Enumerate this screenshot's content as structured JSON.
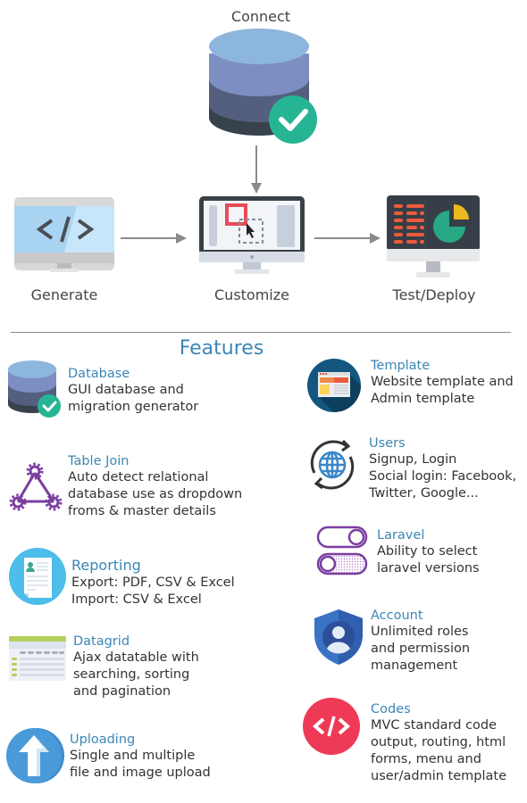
{
  "workflow": {
    "steps": [
      {
        "id": "connect",
        "label": "Connect",
        "icon": "database-check-icon"
      },
      {
        "id": "generate",
        "label": "Generate",
        "icon": "monitor-code-icon"
      },
      {
        "id": "customize",
        "label": "Customize",
        "icon": "monitor-editor-icon"
      },
      {
        "id": "test_deploy",
        "label": "Test/Deploy",
        "icon": "monitor-dashboard-icon"
      }
    ],
    "arrows": [
      {
        "from": "connect",
        "to": "customize"
      },
      {
        "from": "generate",
        "to": "customize"
      },
      {
        "from": "customize",
        "to": "test_deploy"
      }
    ]
  },
  "features": {
    "title": "Features",
    "left": [
      {
        "title": "Database",
        "desc": "GUI database and\nmigration generator",
        "icon": "database-check-icon"
      },
      {
        "title": "Table Join",
        "desc": "Auto detect relational\ndatabase use as dropdown\nfroms & master details",
        "icon": "gears-network-icon"
      },
      {
        "title": "Reporting",
        "desc": "Export: PDF, CSV & Excel\nImport: CSV & Excel",
        "icon": "document-report-icon"
      },
      {
        "title": "Datagrid",
        "desc": "Ajax datatable with\nsearching, sorting\nand pagination",
        "icon": "datagrid-table-icon"
      },
      {
        "title": "Uploading",
        "desc": "Single and multiple\nfile and image upload",
        "icon": "upload-arrow-icon"
      }
    ],
    "right": [
      {
        "title": "Template",
        "desc": "Website template and\nAdmin template",
        "icon": "website-template-icon"
      },
      {
        "title": "Users",
        "desc": "Signup, Login\nSocial login: Facebook,\nTwitter, Google...",
        "icon": "globe-sync-icon"
      },
      {
        "title": "Laravel",
        "desc": "Ability to select\nlaravel versions",
        "icon": "toggle-switches-icon"
      },
      {
        "title": "Account",
        "desc": "Unlimited roles\nand permission\nmanagement",
        "icon": "shield-user-icon"
      },
      {
        "title": "Codes",
        "desc": "MVC standard code\noutput, routing, html\nforms, menu and\nuser/admin template",
        "icon": "code-brackets-icon"
      }
    ]
  },
  "colors": {
    "accent_blue": "#3b86b5",
    "check_green": "#26b594",
    "code_red": "#ee3a57",
    "purple": "#7b3fa0",
    "arrow_gray": "#8a8a8a"
  }
}
